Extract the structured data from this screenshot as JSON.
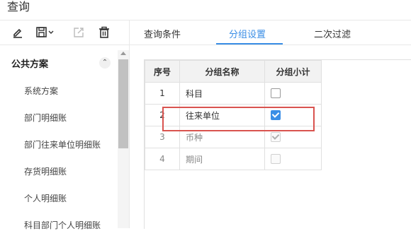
{
  "window": {
    "title": "查询"
  },
  "sidebar": {
    "toolbar": {
      "edit_icon": "pencil-icon",
      "save_icon": "save-icon",
      "export_icon": "export-icon",
      "delete_icon": "trash-icon"
    },
    "section_title": "公共方案",
    "items": [
      {
        "label": "系统方案"
      },
      {
        "label": "部门明细账"
      },
      {
        "label": "部门往来单位明细账"
      },
      {
        "label": "存货明细账"
      },
      {
        "label": "个人明细账"
      },
      {
        "label": "科目部门个人明细账"
      }
    ]
  },
  "tabs": [
    {
      "label": "查询条件",
      "active": false
    },
    {
      "label": "分组设置",
      "active": true
    },
    {
      "label": "二次过滤",
      "active": false
    }
  ],
  "grid": {
    "headers": [
      "序号",
      "分组名称",
      "分组小计"
    ],
    "rows": [
      {
        "index": "1",
        "name": "科目",
        "subtotal": false,
        "disabled": false
      },
      {
        "index": "2",
        "name": "往来单位",
        "subtotal": true,
        "disabled": false
      },
      {
        "index": "3",
        "name": "币种",
        "subtotal": true,
        "disabled": true
      },
      {
        "index": "4",
        "name": "期间",
        "subtotal": false,
        "disabled": true
      }
    ]
  },
  "colors": {
    "accent": "#3a8ee6",
    "highlight": "#d9534f"
  }
}
